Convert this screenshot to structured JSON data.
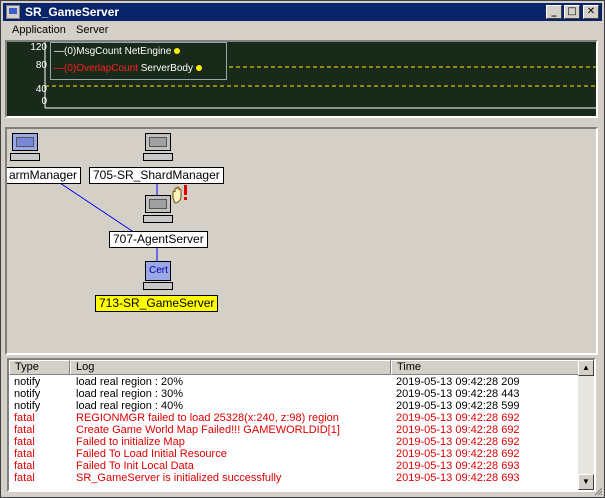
{
  "window": {
    "title": "SR_GameServer",
    "controls": {
      "minimize": "_",
      "maximize": "□",
      "close": "✕"
    }
  },
  "menu": {
    "items": [
      "Application",
      "Server"
    ]
  },
  "graph": {
    "y_ticks": [
      "120",
      "80",
      "40",
      "0"
    ],
    "legend": [
      {
        "prefix": "—(0)",
        "counter": "MsgCount",
        "source": "NetEngine",
        "color": "#ffffff"
      },
      {
        "prefix": "—(0)",
        "counter": "OverlapCount",
        "source": "ServerBody",
        "color": "#ff2020"
      }
    ],
    "colors": {
      "background": "#1a2a1a",
      "dashed_line": "#ffee00",
      "dot": "#ffee00"
    }
  },
  "topology": {
    "nodes": [
      {
        "label": "armManager",
        "icon": "computer-icon"
      },
      {
        "label": "705-SR_ShardManager",
        "icon": "computer-icon"
      },
      {
        "label": "707-AgentServer",
        "icon": "computer-icon"
      },
      {
        "label": "713-SR_GameServer",
        "icon": "computer-icon",
        "badge": "Cert",
        "highlight": "#ffff00"
      }
    ],
    "alert_icon": "hand-alert-icon"
  },
  "log": {
    "columns": [
      "Type",
      "Log",
      "Time"
    ],
    "rows": [
      {
        "type": "notify",
        "message": "load real region : 20%",
        "time": "2019-05-13 09:42:28 209",
        "level": "notify"
      },
      {
        "type": "notify",
        "message": "load real region : 30%",
        "time": "2019-05-13 09:42:28 443",
        "level": "notify"
      },
      {
        "type": "notify",
        "message": "load real region : 40%",
        "time": "2019-05-13 09:42:28 599",
        "level": "notify"
      },
      {
        "type": "fatal",
        "message": "REGIONMGR failed to load 25328(x:240, z:98) region",
        "time": "2019-05-13 09:42:28 692",
        "level": "fatal"
      },
      {
        "type": "fatal",
        "message": "Create Game World Map Failed!!! GAMEWORLDID[1]",
        "time": "2019-05-13 09:42:28 692",
        "level": "fatal"
      },
      {
        "type": "fatal",
        "message": "Failed to initialize Map",
        "time": "2019-05-13 09:42:28 692",
        "level": "fatal"
      },
      {
        "type": "fatal",
        "message": "Failed To Load Initial Resource",
        "time": "2019-05-13 09:42:28 692",
        "level": "fatal"
      },
      {
        "type": "fatal",
        "message": "Failed To Init Local Data",
        "time": "2019-05-13 09:42:28 693",
        "level": "fatal"
      },
      {
        "type": "fatal",
        "message": "SR_GameServer is initialized successfully",
        "time": "2019-05-13 09:42:28 693",
        "level": "fatal"
      }
    ],
    "colors": {
      "notify": "#000000",
      "fatal": "#e00000"
    }
  }
}
